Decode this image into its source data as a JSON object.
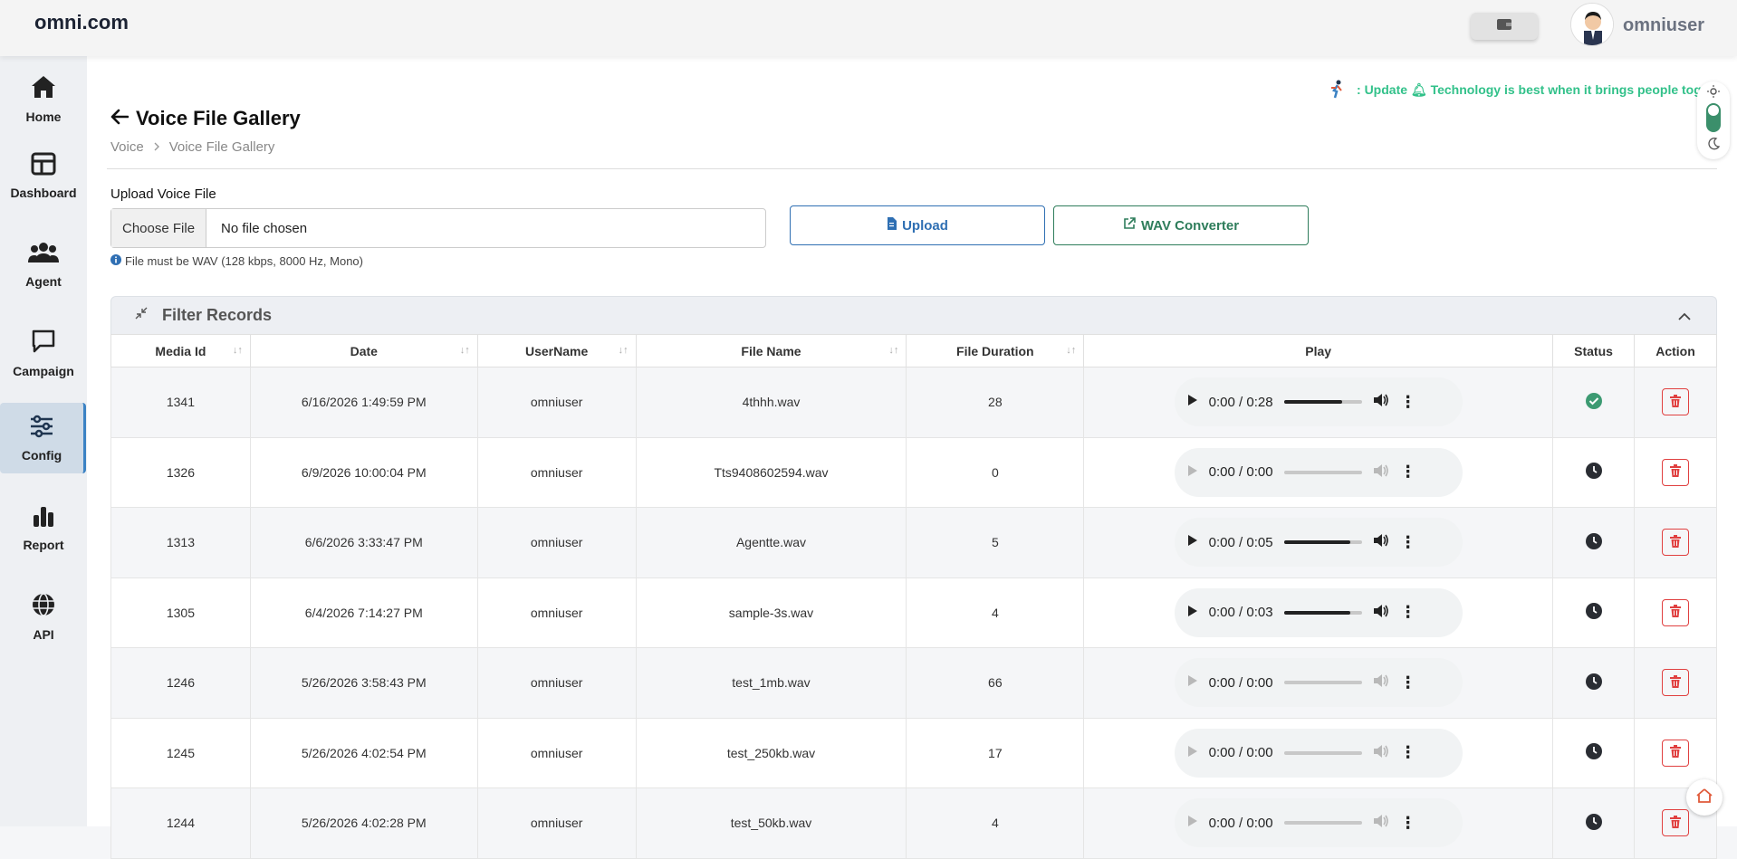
{
  "header": {
    "brand": "omni.com",
    "username": "omniuser"
  },
  "sidebar": {
    "items": [
      {
        "label": "Home",
        "icon": "home-icon"
      },
      {
        "label": "Dashboard",
        "icon": "dashboard-icon"
      },
      {
        "label": "Agent",
        "icon": "agents-icon"
      },
      {
        "label": "Campaign",
        "icon": "chat-icon"
      },
      {
        "label": "Config",
        "icon": "sliders-icon",
        "active": true
      },
      {
        "label": "Report",
        "icon": "bar-chart-icon"
      },
      {
        "label": "API",
        "icon": "globe-icon"
      }
    ]
  },
  "marquee": {
    "prefix": ": ",
    "label": "Update",
    "text": "Technology is best when it brings people toge"
  },
  "page": {
    "title": "Voice File Gallery",
    "breadcrumb": [
      "Voice",
      "Voice File Gallery"
    ]
  },
  "upload": {
    "label": "Upload Voice File",
    "choose_label": "Choose File",
    "chosen_text": "No file chosen",
    "hint": "File must be WAV (128 kbps, 8000 Hz, Mono)",
    "upload_button": "Upload",
    "wav_button": "WAV Converter"
  },
  "filter": {
    "title": "Filter Records"
  },
  "table": {
    "columns": [
      "Media Id",
      "Date",
      "UserName",
      "File Name",
      "File Duration",
      "Play",
      "Status",
      "Action"
    ],
    "rows": [
      {
        "id": "1341",
        "date": "6/16/2026 1:49:59 PM",
        "user": "omniuser",
        "file": "4thhh.wav",
        "duration": "28",
        "time": "0:00 / 0:28",
        "enabled": true,
        "volume": 0.75,
        "status": "check"
      },
      {
        "id": "1326",
        "date": "6/9/2026 10:00:04 PM",
        "user": "omniuser",
        "file": "Tts9408602594.wav",
        "duration": "0",
        "time": "0:00 / 0:00",
        "enabled": false,
        "volume": 0,
        "status": "clock"
      },
      {
        "id": "1313",
        "date": "6/6/2026 3:33:47 PM",
        "user": "omniuser",
        "file": "Agentte.wav",
        "duration": "5",
        "time": "0:00 / 0:05",
        "enabled": true,
        "volume": 0.85,
        "status": "clock"
      },
      {
        "id": "1305",
        "date": "6/4/2026 7:14:27 PM",
        "user": "omniuser",
        "file": "sample-3s.wav",
        "duration": "4",
        "time": "0:00 / 0:03",
        "enabled": true,
        "volume": 0.85,
        "status": "clock"
      },
      {
        "id": "1246",
        "date": "5/26/2026 3:58:43 PM",
        "user": "omniuser",
        "file": "test_1mb.wav",
        "duration": "66",
        "time": "0:00 / 0:00",
        "enabled": false,
        "volume": 0,
        "status": "clock"
      },
      {
        "id": "1245",
        "date": "5/26/2026 4:02:54 PM",
        "user": "omniuser",
        "file": "test_250kb.wav",
        "duration": "17",
        "time": "0:00 / 0:00",
        "enabled": false,
        "volume": 0,
        "status": "clock"
      },
      {
        "id": "1244",
        "date": "5/26/2026 4:02:28 PM",
        "user": "omniuser",
        "file": "test_50kb.wav",
        "duration": "4",
        "time": "0:00 / 0:00",
        "enabled": false,
        "volume": 0,
        "status": "clock"
      }
    ]
  },
  "colors": {
    "accent": "#2f6fb3",
    "success": "#2e7d5b",
    "marquee": "#32c18a",
    "danger": "#e04040"
  }
}
